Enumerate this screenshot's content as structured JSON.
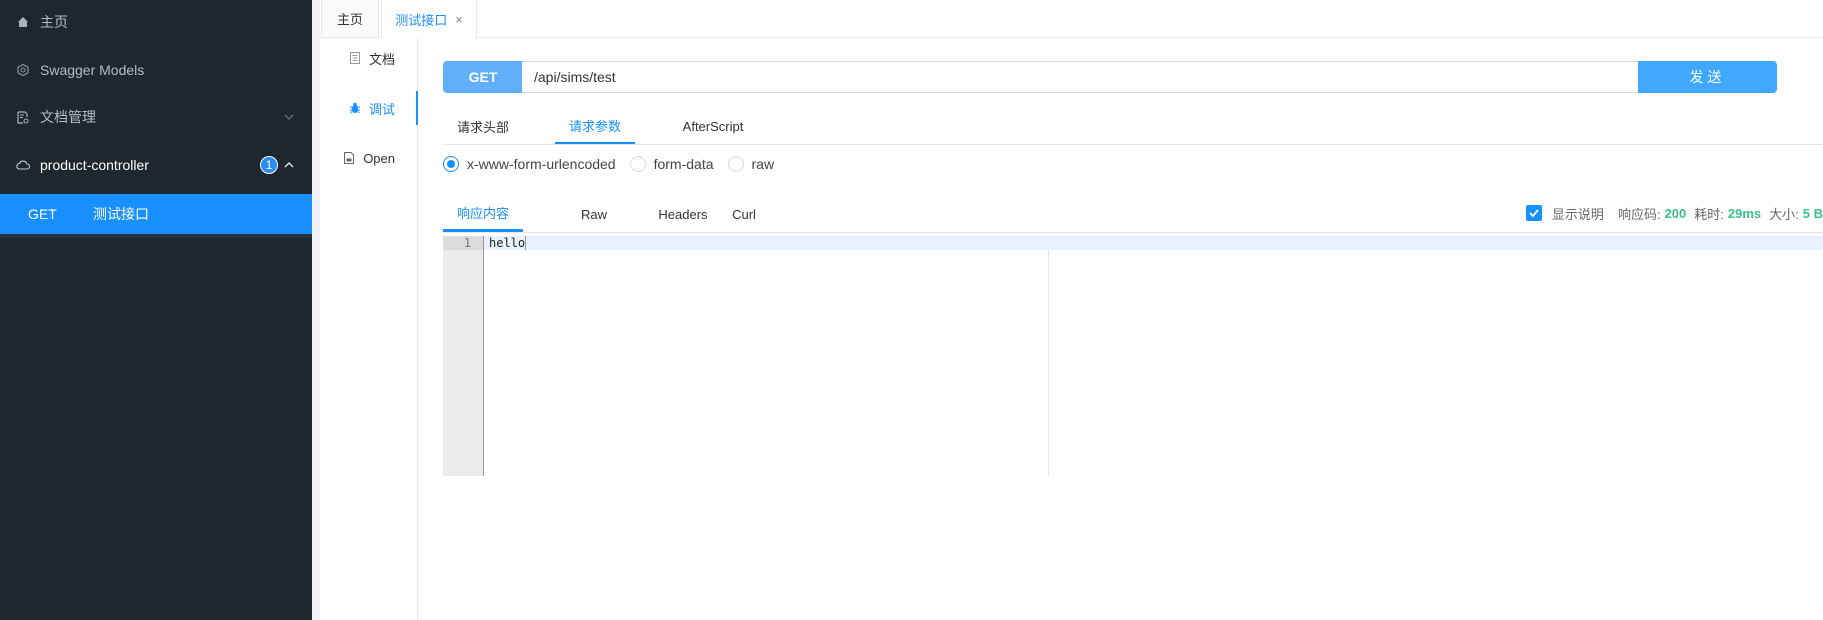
{
  "sidebar": {
    "items": [
      {
        "label": "主页",
        "icon": "home-icon"
      },
      {
        "label": "Swagger Models",
        "icon": "models-icon"
      },
      {
        "label": "文档管理",
        "icon": "doc-manage-icon",
        "chevron": "chevron-down-icon"
      },
      {
        "label": "product-controller",
        "icon": "cloud-icon",
        "badge": "1",
        "chevron": "chevron-up-icon"
      }
    ],
    "active_item": {
      "method": "GET",
      "name": "测试接口"
    }
  },
  "tabs": [
    {
      "label": "主页"
    },
    {
      "label": "测试接口",
      "close": "×"
    }
  ],
  "side_tabs": [
    {
      "label": "文档",
      "icon": "document-icon"
    },
    {
      "label": "调试",
      "icon": "bug-icon"
    },
    {
      "label": "Open",
      "icon": "file-icon"
    }
  ],
  "request": {
    "method": "GET",
    "url": "/api/sims/test",
    "send_label": "发送"
  },
  "request_tabs": [
    {
      "label": "请求头部"
    },
    {
      "label": "请求参数"
    },
    {
      "label": "AfterScript"
    }
  ],
  "content_types": [
    {
      "label": "x-www-form-urlencoded",
      "checked": true
    },
    {
      "label": "form-data",
      "checked": false
    },
    {
      "label": "raw",
      "checked": false
    }
  ],
  "response_tabs": [
    {
      "label": "响应内容"
    },
    {
      "label": "Raw"
    },
    {
      "label": "Headers"
    },
    {
      "label": "Curl"
    }
  ],
  "response_status": {
    "show_desc_label": "显示说明",
    "show_desc_checked": true,
    "code_label": "响应码:",
    "code": "200",
    "time_label": "耗时:",
    "time": "29ms",
    "size_label": "大小:",
    "size": "5 B"
  },
  "editor": {
    "line_number": "1",
    "content": "hello"
  },
  "colors": {
    "accent": "#1890ff",
    "sidebar_bg": "#1f272e",
    "method_bg": "#61aefb",
    "send_bg": "#40a9ff",
    "status_green": "#3cc08a"
  }
}
